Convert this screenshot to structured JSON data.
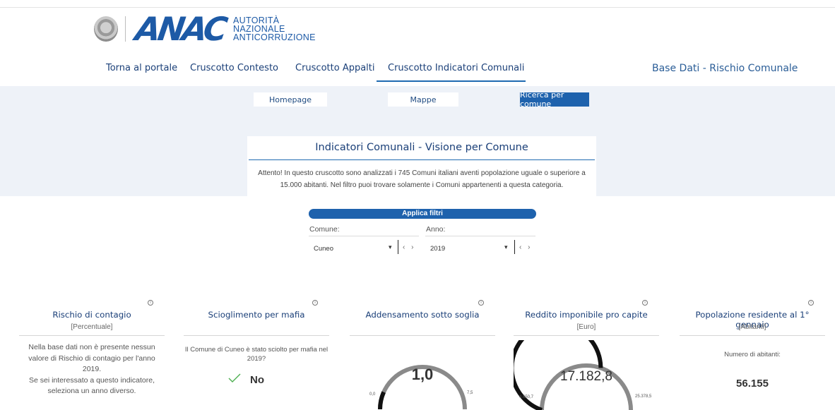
{
  "logo": {
    "wordmark": "ANAC",
    "subtitle": [
      "AUTORITÀ",
      "NAZIONALE",
      "ANTICORRUZIONE"
    ]
  },
  "nav": {
    "items": [
      {
        "label": "Torna al portale"
      },
      {
        "label": "Cruscotto Contesto"
      },
      {
        "label": "Cruscotto Appalti"
      },
      {
        "label": "Cruscotto Indicatori Comunali",
        "active": true
      }
    ],
    "right_label": "Base Dati - Rischio Comunale"
  },
  "subnav": {
    "homepage": "Homepage",
    "mappe": "Mappe",
    "ricerca": "Ricerca per comune"
  },
  "info": {
    "title": "Indicatori Comunali - Visione per Comune",
    "text": "Attento! In questo cruscotto sono analizzati i 745 Comuni italiani aventi popolazione uguale o superiore a 15.000 abitanti. Nel filtro puoi trovare solamente i Comuni appartenenti a questa categoria."
  },
  "filters": {
    "apply_label": "Applica filtri",
    "comune_label": "Comune:",
    "comune_value": "Cuneo",
    "anno_label": "Anno:",
    "anno_value": "2019",
    "caret": "▾",
    "arrows": "‹ ›"
  },
  "cards": {
    "rischio": {
      "title": "Rischio di contagio",
      "unit": "[Percentuale]",
      "message": "Nella base dati non è presente nessun valore di Rischio di contagio per l'anno 2019.\nSe sei interessato a questo indicatore, seleziona un anno diverso."
    },
    "scioglimento": {
      "title": "Scioglimento per mafia",
      "question": "Il Comune di Cuneo è stato sciolto per mafia nel 2019?",
      "answer": "No"
    },
    "addensamento": {
      "title": "Addensamento sotto soglia",
      "value": "1,0",
      "min": "0,0",
      "max": "7,5",
      "fraction": 0.133
    },
    "reddito": {
      "title": "Reddito imponibile pro capite",
      "unit": "[Euro]",
      "value": "17.182,8",
      "min": "4.650,7",
      "max": "25.378,5",
      "fraction": 0.605
    },
    "popolazione": {
      "title": "Popolazione residente al 1° gennaio",
      "unit": "[Abitanti]",
      "label": "Numero di abitanti:",
      "value": "56.155"
    }
  },
  "colors": {
    "brand_blue": "#1d5aa6",
    "nav_text": "#1a3f78",
    "band_bg": "#eef2f8",
    "gauge_fill": "#111111",
    "gauge_track": "#8a8a8a",
    "check_green": "#4caf50"
  }
}
